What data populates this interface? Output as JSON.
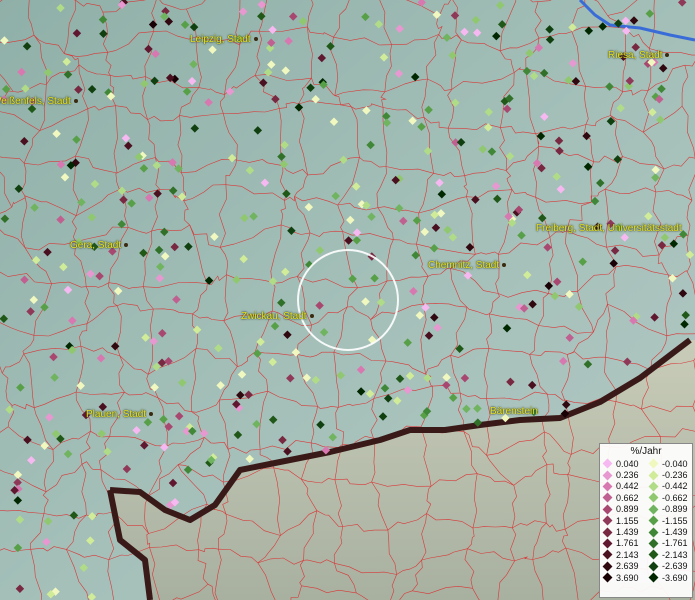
{
  "cities": [
    {
      "name": "Leipzig, Stadt",
      "id": "leipzig"
    },
    {
      "name": "Riesa, Stadt",
      "id": "riesa"
    },
    {
      "name": "Weißenfels, Stadt",
      "id": "weissenfels"
    },
    {
      "name": "Gera, Stadt",
      "id": "gera"
    },
    {
      "name": "Freiberg, Stadt, Universitätsstadt",
      "id": "freiberg"
    },
    {
      "name": "Chemnitz, Stadt",
      "id": "chemnitz"
    },
    {
      "name": "Zwickau, Stadt",
      "id": "zwickau"
    },
    {
      "name": "Plauen, Stadt",
      "id": "plauen"
    },
    {
      "name": "Bärenstein",
      "id": "baerenstein"
    }
  ],
  "legend": {
    "title": "%/Jahr",
    "positive": [
      {
        "value": "0.040",
        "color": "#f6b8f0"
      },
      {
        "value": "0.236",
        "color": "#e898d0"
      },
      {
        "value": "0.442",
        "color": "#d878b0"
      },
      {
        "value": "0.662",
        "color": "#c06090"
      },
      {
        "value": "0.899",
        "color": "#a84870"
      },
      {
        "value": "1.155",
        "color": "#903858"
      },
      {
        "value": "1.439",
        "color": "#782840"
      },
      {
        "value": "1.761",
        "color": "#601830"
      },
      {
        "value": "2.143",
        "color": "#4a1020"
      },
      {
        "value": "2.639",
        "color": "#300810"
      },
      {
        "value": "3.690",
        "color": "#180005"
      }
    ],
    "negative": [
      {
        "value": "-0.040",
        "color": "#f0f8c0"
      },
      {
        "value": "-0.236",
        "color": "#d0ec98"
      },
      {
        "value": "-0.442",
        "color": "#b0dc88"
      },
      {
        "value": "-0.662",
        "color": "#90c870"
      },
      {
        "value": "-0.899",
        "color": "#70b460"
      },
      {
        "value": "-1.155",
        "color": "#58a048"
      },
      {
        "value": "-1.439",
        "color": "#408838"
      },
      {
        "value": "-1.761",
        "color": "#307028"
      },
      {
        "value": "-2.143",
        "color": "#205818"
      },
      {
        "value": "-2.639",
        "color": "#104010"
      },
      {
        "value": "-3.690",
        "color": "#002800"
      }
    ]
  },
  "colors": {
    "background": "#9bb8b0",
    "borders": "#d03030",
    "country_border": "#2a1414",
    "river": "#3a6cd8",
    "label": "#e8e020"
  }
}
